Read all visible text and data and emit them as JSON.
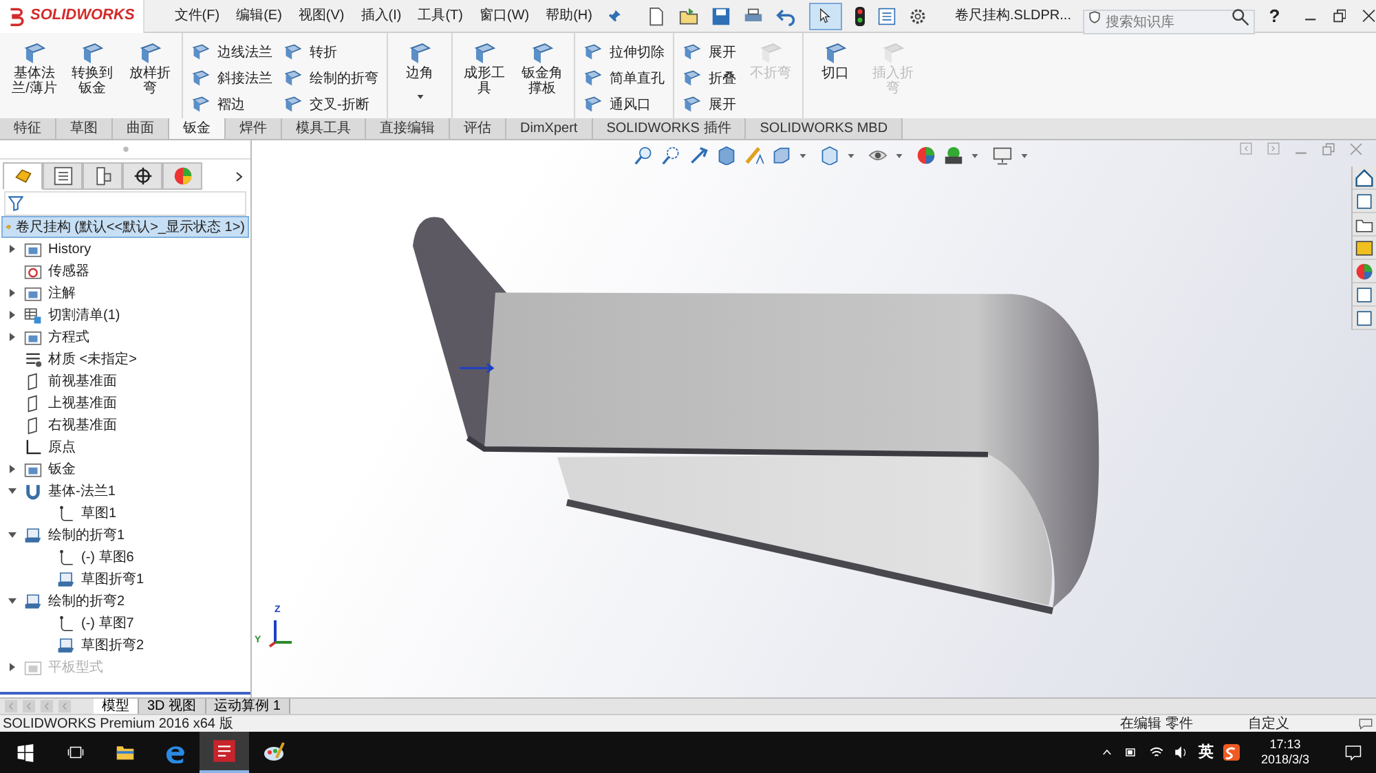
{
  "app": {
    "logo_text": "SOLIDWORKS",
    "menus": [
      "文件(F)",
      "编辑(E)",
      "视图(V)",
      "插入(I)",
      "工具(T)",
      "窗口(W)",
      "帮助(H)"
    ],
    "file_name": "卷尺挂构.SLDPR...",
    "search": {
      "placeholder": "搜索知识库"
    },
    "help": "?"
  },
  "ribbon": [
    {
      "kind": "large",
      "label": "基体法兰/薄片",
      "disabled": false,
      "separator": false
    },
    {
      "kind": "large",
      "label": "转换到钣金",
      "disabled": false,
      "separator": false
    },
    {
      "kind": "large",
      "label": "放样折弯",
      "disabled": false,
      "separator": true
    },
    {
      "kind": "stack",
      "items": [
        "边线法兰",
        "斜接法兰",
        "褶边"
      ],
      "separator": false
    },
    {
      "kind": "stack",
      "items": [
        "转折",
        "绘制的折弯",
        "交叉-折断"
      ],
      "separator": true
    },
    {
      "kind": "large",
      "label": "边角",
      "disabled": false,
      "separator": true,
      "dropdown": true
    },
    {
      "kind": "large",
      "label": "成形工具",
      "disabled": false,
      "separator": false
    },
    {
      "kind": "large",
      "label": "钣金角撑板",
      "disabled": false,
      "separator": true
    },
    {
      "kind": "stack",
      "items": [
        "拉伸切除",
        "简单直孔",
        "通风口"
      ],
      "separator": true
    },
    {
      "kind": "stack",
      "items": [
        "展开",
        "折叠",
        "展开"
      ],
      "separator": false
    },
    {
      "kind": "large",
      "label": "不折弯",
      "disabled": true,
      "separator": true
    },
    {
      "kind": "large",
      "label": "切口",
      "disabled": false,
      "separator": false
    },
    {
      "kind": "large",
      "label": "插入折弯",
      "disabled": true,
      "separator": false
    }
  ],
  "command_tabs": [
    {
      "label": "特征",
      "selected": false
    },
    {
      "label": "草图",
      "selected": false
    },
    {
      "label": "曲面",
      "selected": false
    },
    {
      "label": "钣金",
      "selected": true
    },
    {
      "label": "焊件",
      "selected": false
    },
    {
      "label": "模具工具",
      "selected": false
    },
    {
      "label": "直接编辑",
      "selected": false
    },
    {
      "label": "评估",
      "selected": false
    },
    {
      "label": "DimXpert",
      "selected": false
    },
    {
      "label": "SOLIDWORKS 插件",
      "selected": false
    },
    {
      "label": "SOLIDWORKS MBD",
      "selected": false
    }
  ],
  "panel_tabs": [
    {
      "selected": true
    },
    {
      "selected": false
    },
    {
      "selected": false
    },
    {
      "selected": false
    },
    {
      "selected": false
    }
  ],
  "tree": {
    "root": {
      "label": "卷尺挂构  (默认<<默认>_显示状态 1>)",
      "selected": true
    },
    "items": [
      {
        "label": "History",
        "kind": "folder",
        "expanded": false,
        "disabled": false
      },
      {
        "label": "传感器",
        "kind": "sensor",
        "disabled": false
      },
      {
        "label": "注解",
        "kind": "folder",
        "expanded": false,
        "disabled": false
      },
      {
        "label": "切割清单(1)",
        "kind": "cutlist",
        "expanded": false,
        "disabled": false
      },
      {
        "label": "方程式",
        "kind": "folder",
        "expanded": false,
        "disabled": false
      },
      {
        "label": "材质 <未指定>",
        "kind": "material",
        "disabled": false
      },
      {
        "label": "前视基准面",
        "kind": "plane",
        "disabled": false
      },
      {
        "label": "上视基准面",
        "kind": "plane",
        "disabled": false
      },
      {
        "label": "右视基准面",
        "kind": "plane",
        "disabled": false
      },
      {
        "label": "原点",
        "kind": "origin",
        "disabled": false
      },
      {
        "label": "钣金",
        "kind": "folder",
        "expanded": false,
        "disabled": false
      },
      {
        "label": "基体-法兰1",
        "kind": "flange",
        "expanded": true,
        "disabled": false,
        "children": [
          {
            "label": "草图1",
            "kind": "sketch",
            "disabled": false
          }
        ]
      },
      {
        "label": "绘制的折弯1",
        "kind": "bend",
        "expanded": true,
        "disabled": false,
        "children": [
          {
            "label": "(-) 草图6",
            "kind": "sketch",
            "disabled": false
          },
          {
            "label": "草图折弯1",
            "kind": "bend",
            "disabled": false
          }
        ]
      },
      {
        "label": "绘制的折弯2",
        "kind": "bend",
        "expanded": true,
        "disabled": false,
        "children": [
          {
            "label": "(-) 草图7",
            "kind": "sketch",
            "disabled": false
          },
          {
            "label": "草图折弯2",
            "kind": "bend",
            "disabled": false
          }
        ]
      },
      {
        "label": "平板型式",
        "kind": "folder",
        "expanded": false,
        "disabled": true
      }
    ]
  },
  "bottom_tabs": [
    {
      "label": "模型",
      "selected": true
    },
    {
      "label": "3D 视图",
      "selected": false
    },
    {
      "label": "运动算例 1",
      "selected": false
    }
  ],
  "triad": {
    "z": "Z",
    "y": "Y"
  },
  "status_bar": {
    "product": "SOLIDWORKS Premium 2016 x64 版",
    "mode": "在编辑 零件",
    "units": "自定义"
  },
  "taskbar": {
    "ime": "英",
    "time": "17:13",
    "date": "2018/3/3"
  }
}
